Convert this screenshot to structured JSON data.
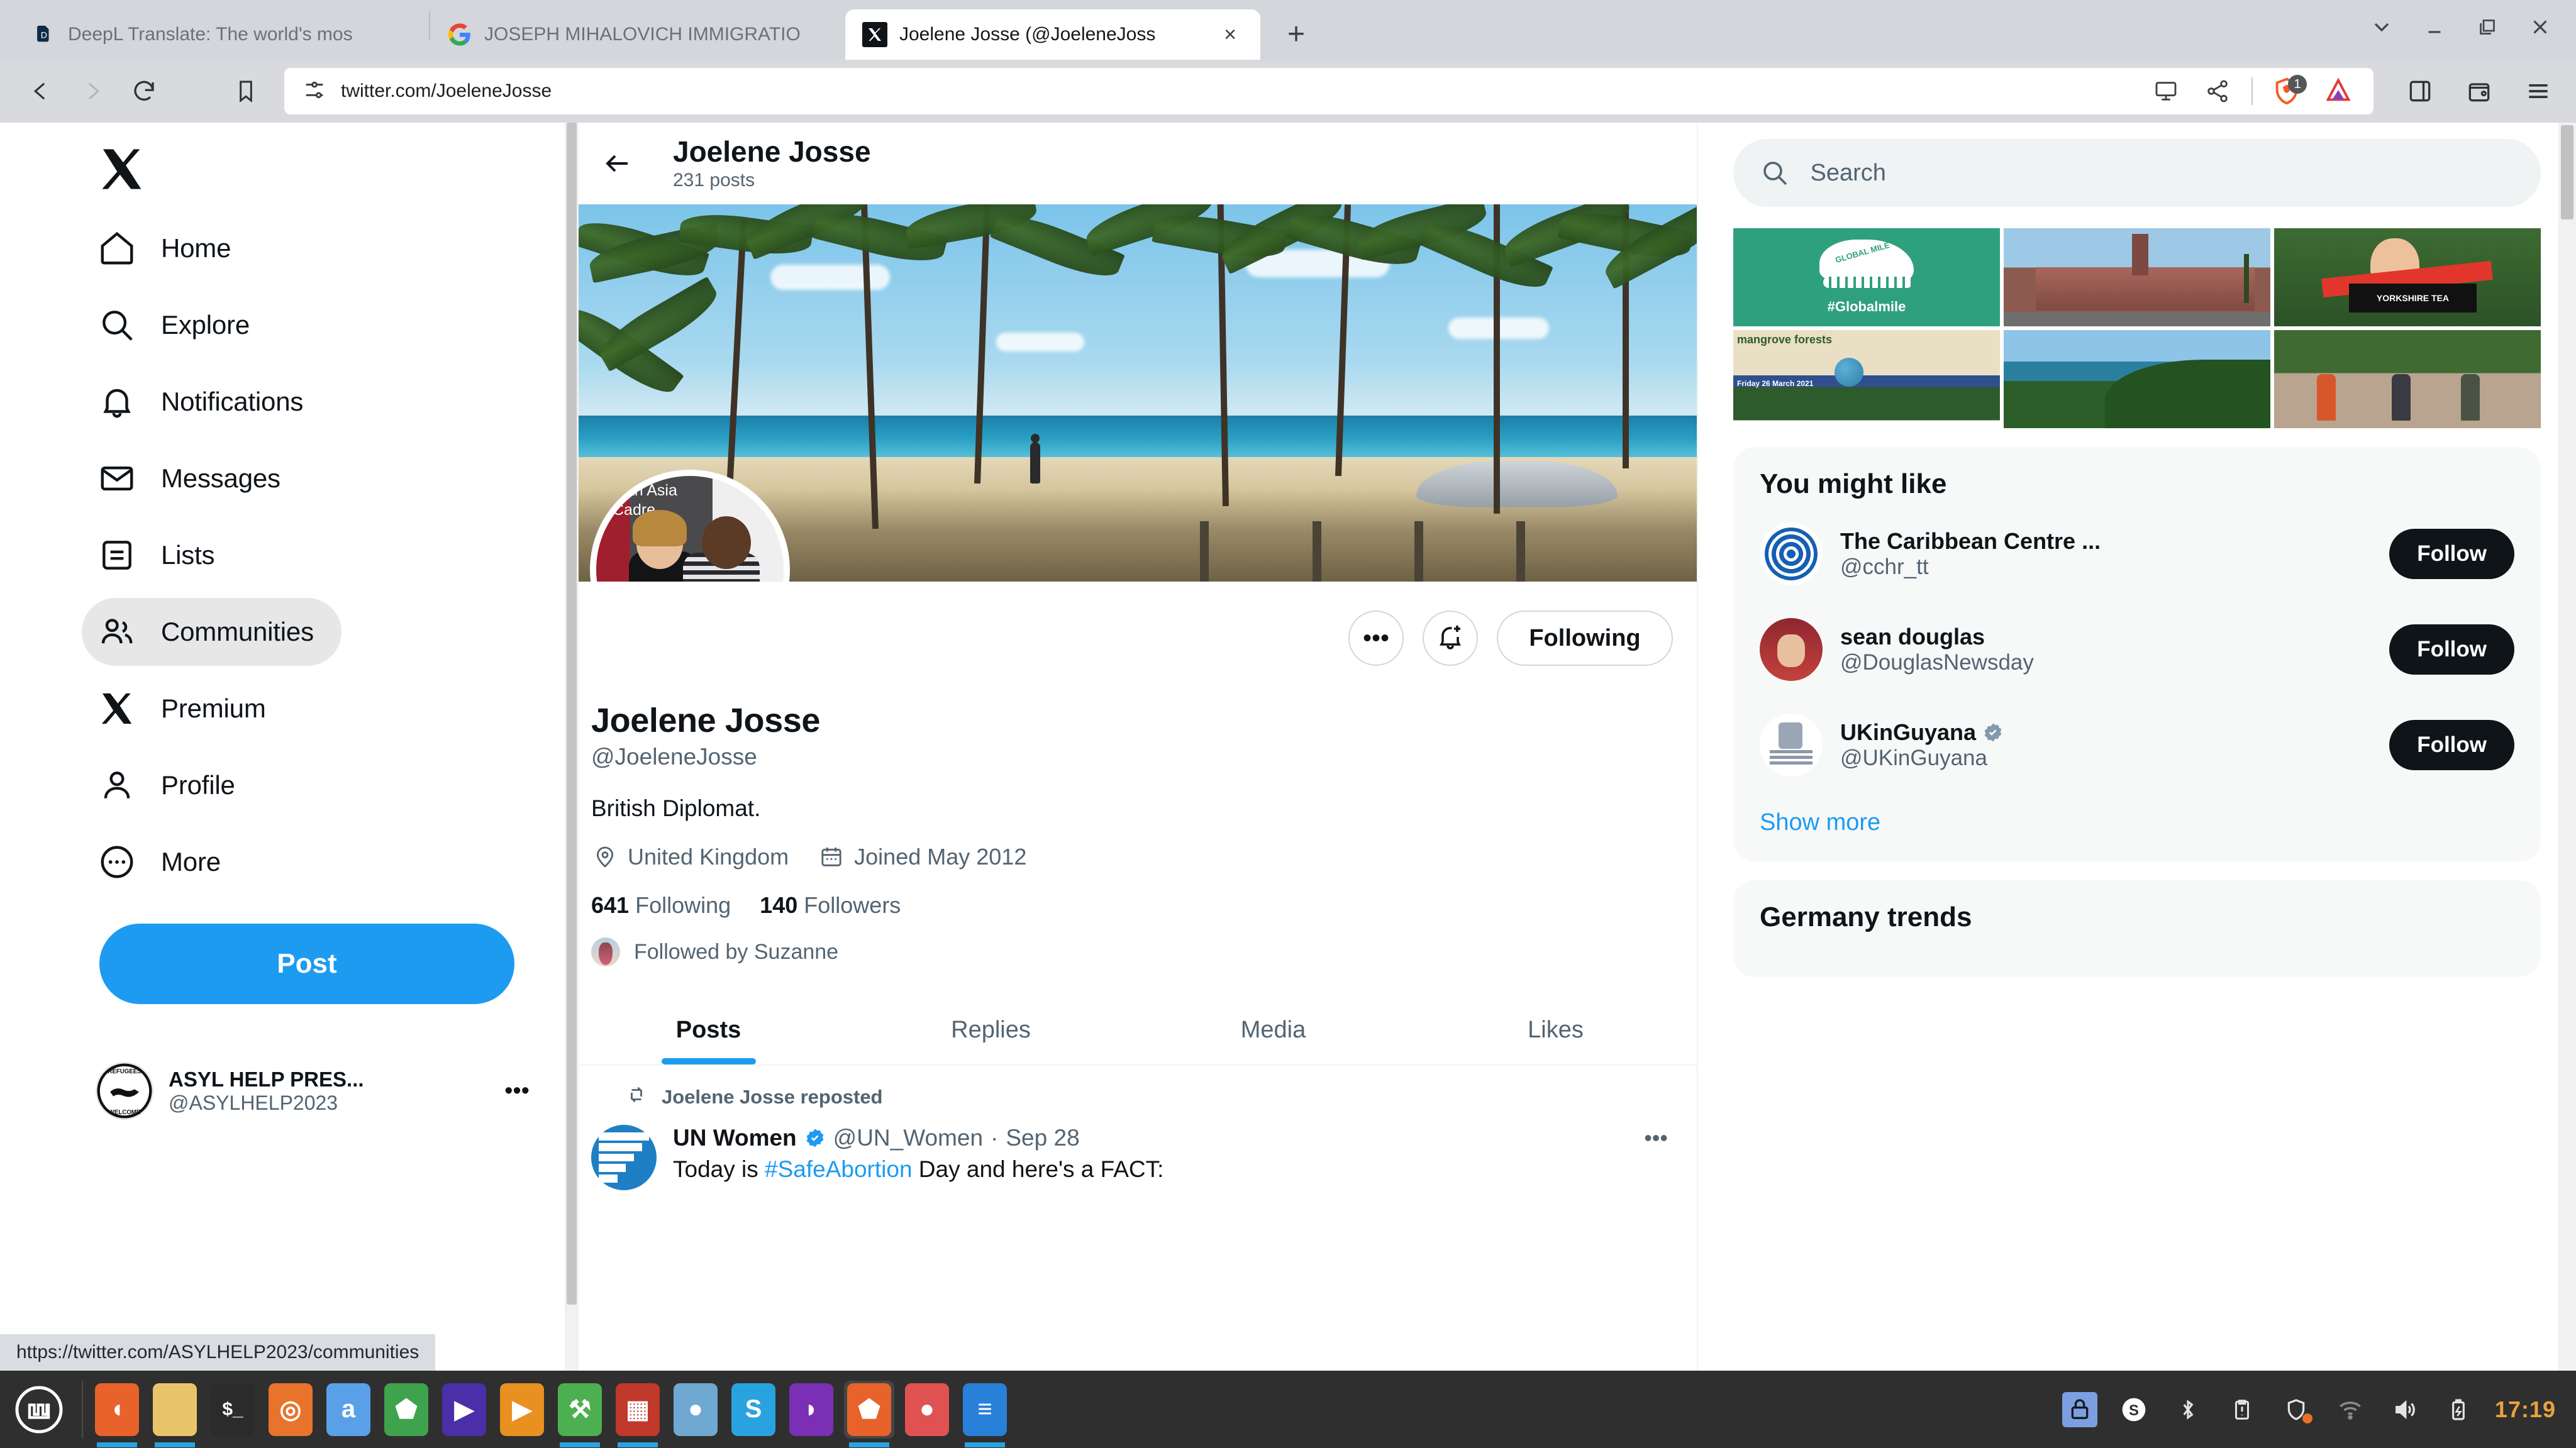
{
  "browser": {
    "tabs": [
      {
        "title": "DeepL Translate: The world's mos",
        "favicon": "deepl-icon",
        "active": false
      },
      {
        "title": "JOSEPH MIHALOVICH IMMIGRATIO",
        "favicon": "google-icon",
        "active": false
      },
      {
        "title": "Joelene Josse (@JoeleneJoss",
        "favicon": "x-icon",
        "active": true
      }
    ],
    "new_tab_label": "+",
    "tab_close_label": "×",
    "url": "twitter.com/JoeleneJosse",
    "nav": {
      "back": "back-arrow",
      "forward": "forward-arrow",
      "reload": "reload-icon",
      "bookmark": "bookmark-icon"
    },
    "url_icons": [
      "site-settings-icon",
      "cast-icon",
      "share-icon"
    ],
    "extensions": [
      {
        "name": "brave-shields-icon",
        "badge": "1"
      },
      {
        "name": "brave-rewards-icon",
        "badge": ""
      }
    ],
    "right_icons": [
      "sidebar-icon",
      "wallet-icon",
      "menu-icon"
    ],
    "window_controls": [
      "chevron-down-icon",
      "minimize-icon",
      "restore-icon",
      "close-icon"
    ],
    "status_url": "https://twitter.com/ASYLHELP2023/communities"
  },
  "sidebar": {
    "logo": "x-logo",
    "items": [
      {
        "label": "Home",
        "icon": "home-icon",
        "active": false
      },
      {
        "label": "Explore",
        "icon": "search-icon",
        "active": false
      },
      {
        "label": "Notifications",
        "icon": "bell-icon",
        "active": false
      },
      {
        "label": "Messages",
        "icon": "envelope-icon",
        "active": false
      },
      {
        "label": "Lists",
        "icon": "list-icon",
        "active": false
      },
      {
        "label": "Communities",
        "icon": "communities-icon",
        "active": true
      },
      {
        "label": "Premium",
        "icon": "x-icon",
        "active": false
      },
      {
        "label": "Profile",
        "icon": "person-icon",
        "active": false
      },
      {
        "label": "More",
        "icon": "more-circle-icon",
        "active": false
      }
    ],
    "post_button": "Post",
    "account": {
      "name": "ASYL HELP PRES...",
      "handle": "@ASYLHELP2023",
      "more": "•••"
    }
  },
  "profile_header": {
    "back_icon": "back-arrow-icon",
    "name": "Joelene Josse",
    "posts_count": "231 posts"
  },
  "profile": {
    "name": "Joelene Josse",
    "handle": "@JoeleneJosse",
    "bio": "British Diplomat.",
    "location": "United Kingdom",
    "location_icon": "location-pin-icon",
    "joined": "Joined May 2012",
    "joined_icon": "calendar-icon",
    "following_count": "641",
    "following_label": "Following",
    "followers_count": "140",
    "followers_label": "Followers",
    "followed_by": "Followed by Suzanne",
    "avatar_banner_line1": "outh Asia",
    "avatar_banner_line2": "Cadre",
    "actions": {
      "more": "•••",
      "notify_icon": "bell-plus-icon",
      "follow_state": "Following"
    }
  },
  "tabs": [
    {
      "label": "Posts",
      "active": true
    },
    {
      "label": "Replies",
      "active": false
    },
    {
      "label": "Media",
      "active": false
    },
    {
      "label": "Likes",
      "active": false
    }
  ],
  "feed": [
    {
      "repost_icon": "retweet-icon",
      "repost_label": "Joelene Josse reposted",
      "author": "UN Women",
      "verified": true,
      "handle": "@UN_Women",
      "separator": "·",
      "date": "Sep 28",
      "more": "•••",
      "text_before": "Today is ",
      "hashtag": "#SafeAbortion",
      "text_after": " Day and here's a FACT:"
    }
  ],
  "search": {
    "placeholder": "Search",
    "icon": "search-icon"
  },
  "photo_grid": [
    {
      "name": "globalmile-shoe-graphic",
      "caption": "#Globalmile",
      "shoe_text": "GLOBAL MILE"
    },
    {
      "name": "red-house-building-photo",
      "caption": ""
    },
    {
      "name": "yorkshire-tea-woman-photo",
      "caption": "YORKSHIRE TEA"
    },
    {
      "name": "mangrove-forests-poster",
      "caption": "mangrove forests",
      "date": "Friday 26 March 2021"
    },
    {
      "name": "tropical-bay-coastline-photo",
      "caption": ""
    },
    {
      "name": "award-recipients-group-photo",
      "caption": ""
    }
  ],
  "you_might_like": {
    "title": "You might like",
    "suggestions": [
      {
        "name": "The Caribbean Centre ...",
        "handle": "@cchr_tt",
        "verified": false,
        "follow": "Follow",
        "avatar": "cchr-logo-avatar"
      },
      {
        "name": "sean douglas",
        "handle": "@DouglasNewsday",
        "verified": false,
        "follow": "Follow",
        "avatar": "sean-douglas-avatar"
      },
      {
        "name": "UKinGuyana",
        "handle": "@UKinGuyana",
        "verified": true,
        "follow": "Follow",
        "avatar": "ukinguyana-crest-avatar"
      }
    ],
    "show_more": "Show more"
  },
  "trends": {
    "title": "Germany trends"
  },
  "taskbar": {
    "menu_icon": "linux-mint-menu-icon",
    "apps": [
      {
        "name": "firefox",
        "color": "#e8622b",
        "glyph": "◖"
      },
      {
        "name": "files",
        "color": "#e9c46a",
        "glyph": ""
      },
      {
        "name": "terminal",
        "color": "#2b2b2b",
        "glyph": "$_"
      },
      {
        "name": "blender",
        "color": "#e8742b",
        "glyph": "◎"
      },
      {
        "name": "atom",
        "color": "#5aa0e8",
        "glyph": "a"
      },
      {
        "name": "shield-app",
        "color": "#3fa34d",
        "glyph": "⬟"
      },
      {
        "name": "media-player",
        "color": "#4b2fa8",
        "glyph": "▶"
      },
      {
        "name": "vlc",
        "color": "#e89020",
        "glyph": "▶"
      },
      {
        "name": "tools",
        "color": "#4caf50",
        "glyph": "⚒"
      },
      {
        "name": "brick-app",
        "color": "#c0392b",
        "glyph": "▦"
      },
      {
        "name": "water-app",
        "color": "#6fa8d0",
        "glyph": "●"
      },
      {
        "name": "skype",
        "color": "#29a3e0",
        "glyph": "S"
      },
      {
        "name": "purple-app",
        "color": "#7b2fb5",
        "glyph": "◗"
      },
      {
        "name": "brave",
        "color": "#e8622b",
        "glyph": "⬟"
      },
      {
        "name": "audio-rec",
        "color": "#e05252",
        "glyph": "●"
      },
      {
        "name": "text-editor",
        "color": "#2980d9",
        "glyph": "≡"
      }
    ],
    "tray": [
      "screenshot-icon",
      "skype-tray-icon",
      "bluetooth-icon",
      "clipboard-icon",
      "shield-tray-icon",
      "wifi-icon",
      "volume-icon",
      "battery-icon"
    ],
    "clock": "17:19"
  }
}
